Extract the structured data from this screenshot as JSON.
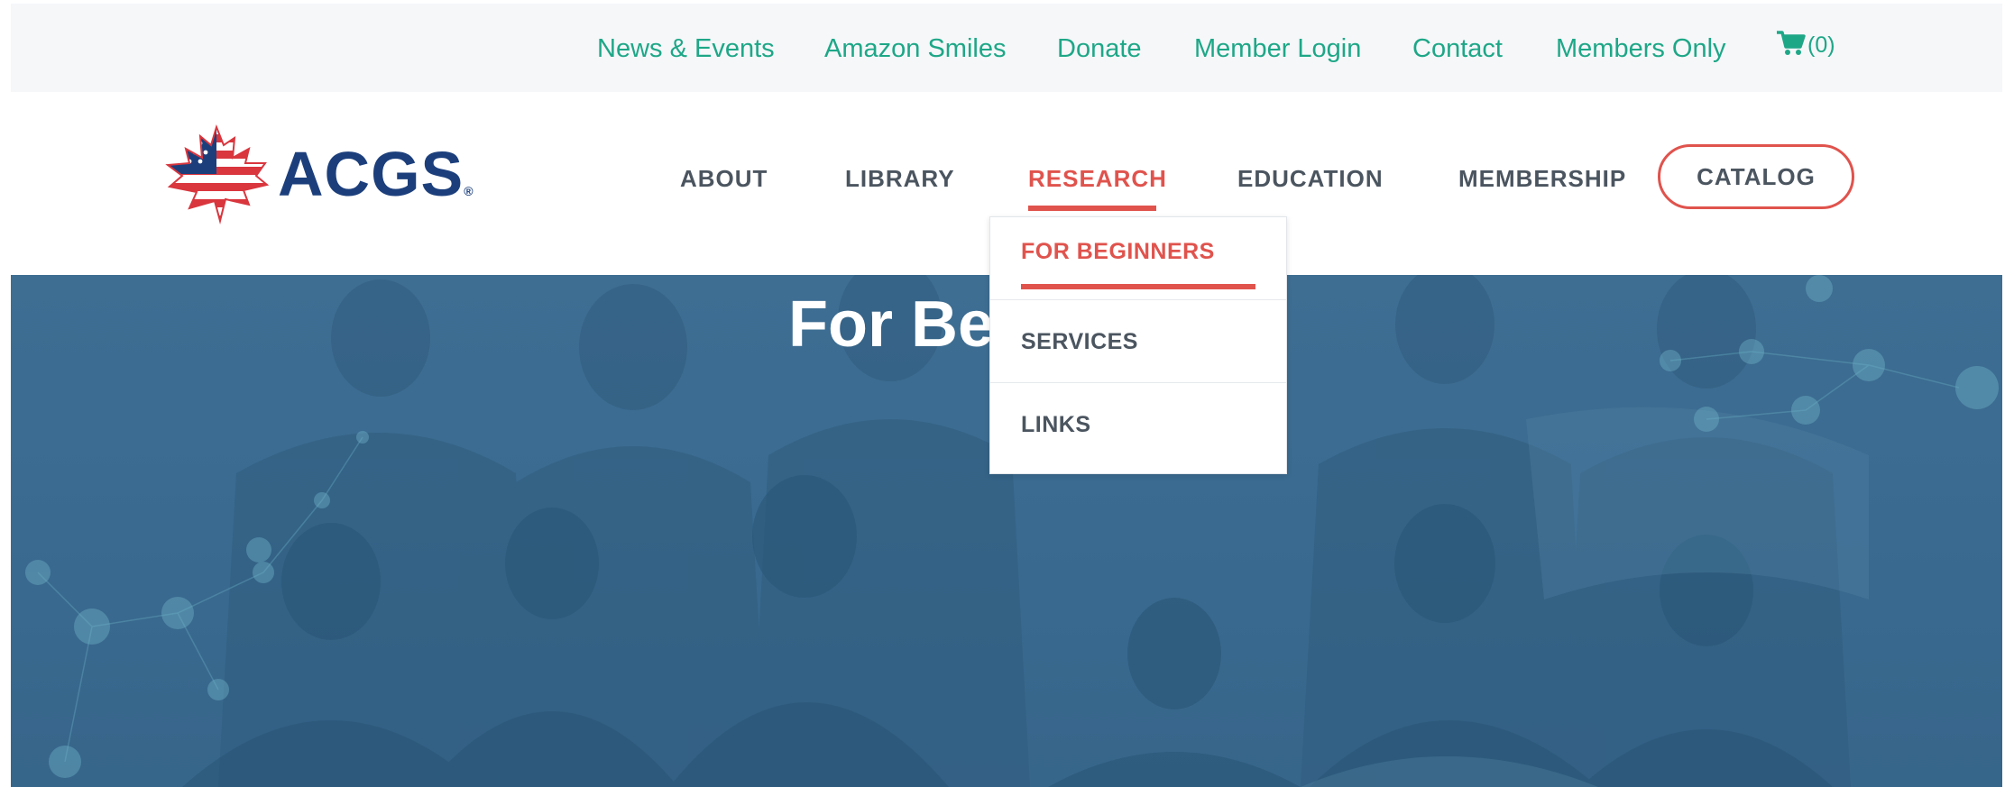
{
  "topbar": {
    "links": [
      {
        "label": "News & Events"
      },
      {
        "label": "Amazon Smiles"
      },
      {
        "label": "Donate"
      },
      {
        "label": "Member Login"
      },
      {
        "label": "Contact"
      },
      {
        "label": "Members Only"
      }
    ],
    "cart": {
      "icon": "cart-icon",
      "count": "(0)"
    }
  },
  "header": {
    "logo": {
      "text": "ACGS",
      "registered": "®",
      "icon": "flag-maple-leaf-icon"
    },
    "nav": [
      {
        "label": "ABOUT"
      },
      {
        "label": "LIBRARY"
      },
      {
        "label": "RESEARCH"
      },
      {
        "label": "EDUCATION"
      },
      {
        "label": "MEMBERSHIP"
      }
    ],
    "catalog_button": "CATALOG"
  },
  "dropdown": {
    "items": [
      {
        "label": "FOR BEGINNERS"
      },
      {
        "label": "SERVICES"
      },
      {
        "label": "LINKS"
      }
    ]
  },
  "hero": {
    "title": "For Be"
  },
  "colors": {
    "accent": "#e0534d",
    "link": "#1ea787",
    "nav_text": "#4b5560",
    "logo_blue": "#1c3f7c",
    "hero_overlay": "#3a6a8f"
  }
}
